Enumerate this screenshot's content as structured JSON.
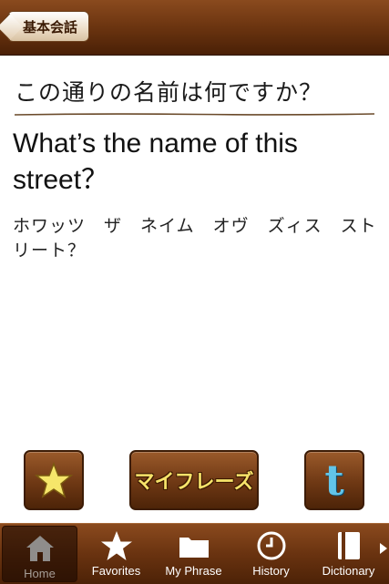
{
  "nav": {
    "back_label": "基本会話"
  },
  "phrase": {
    "japanese": "この通りの名前は何ですか？",
    "english": "What’s the name of this street？",
    "reading": "ホワッツ　ザ　ネイム　オヴ　ズィス　ストリート？"
  },
  "actions": {
    "favorite_icon": "star-icon",
    "myphrase_label": "マイフレーズ",
    "twitter_icon": "twitter-icon",
    "twitter_letter": "t"
  },
  "tabs": [
    {
      "label": "Home",
      "icon": "home-icon",
      "selected": true
    },
    {
      "label": "Favorites",
      "icon": "star-icon",
      "selected": false
    },
    {
      "label": "My Phrase",
      "icon": "folder-icon",
      "selected": false
    },
    {
      "label": "History",
      "icon": "clock-icon",
      "selected": false
    },
    {
      "label": "Dictionary",
      "icon": "book-icon",
      "selected": false
    }
  ],
  "colors": {
    "bar_brown": "#6b3410",
    "star_yellow": "#f6e66a",
    "twitter_blue": "#62c4e8"
  }
}
